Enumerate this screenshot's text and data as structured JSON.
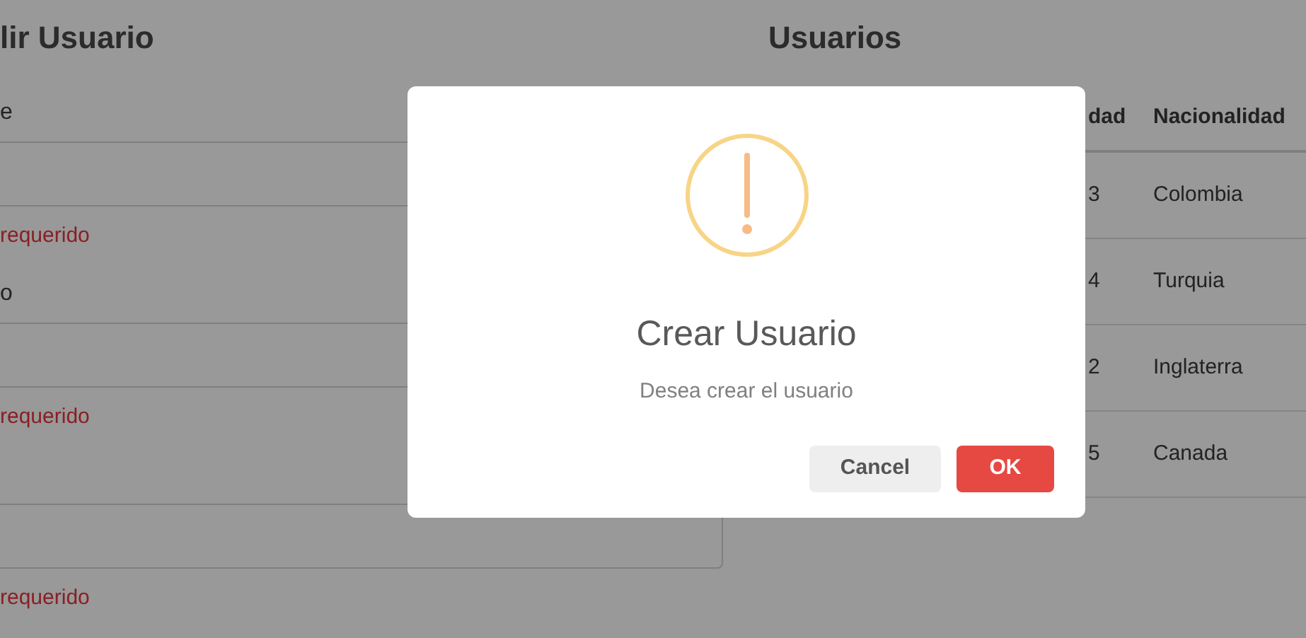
{
  "form": {
    "title": "lir Usuario",
    "fields": [
      {
        "label": "e",
        "error": "requerido"
      },
      {
        "label": "o",
        "error": "requerido"
      },
      {
        "error": "requerido"
      }
    ]
  },
  "users": {
    "title": "Usuarios",
    "columns": [
      "dad",
      "Nacionalidad"
    ],
    "rows": [
      [
        "3",
        "Colombia"
      ],
      [
        "4",
        "Turquia"
      ],
      [
        "2",
        "Inglaterra"
      ],
      [
        "5",
        "Canada"
      ]
    ]
  },
  "dialog": {
    "title": "Crear Usuario",
    "message": "Desea crear el usuario",
    "buttons": [
      {
        "label": "Cancel",
        "kind": "cancel"
      },
      {
        "label": "OK",
        "kind": "confirm"
      }
    ]
  }
}
